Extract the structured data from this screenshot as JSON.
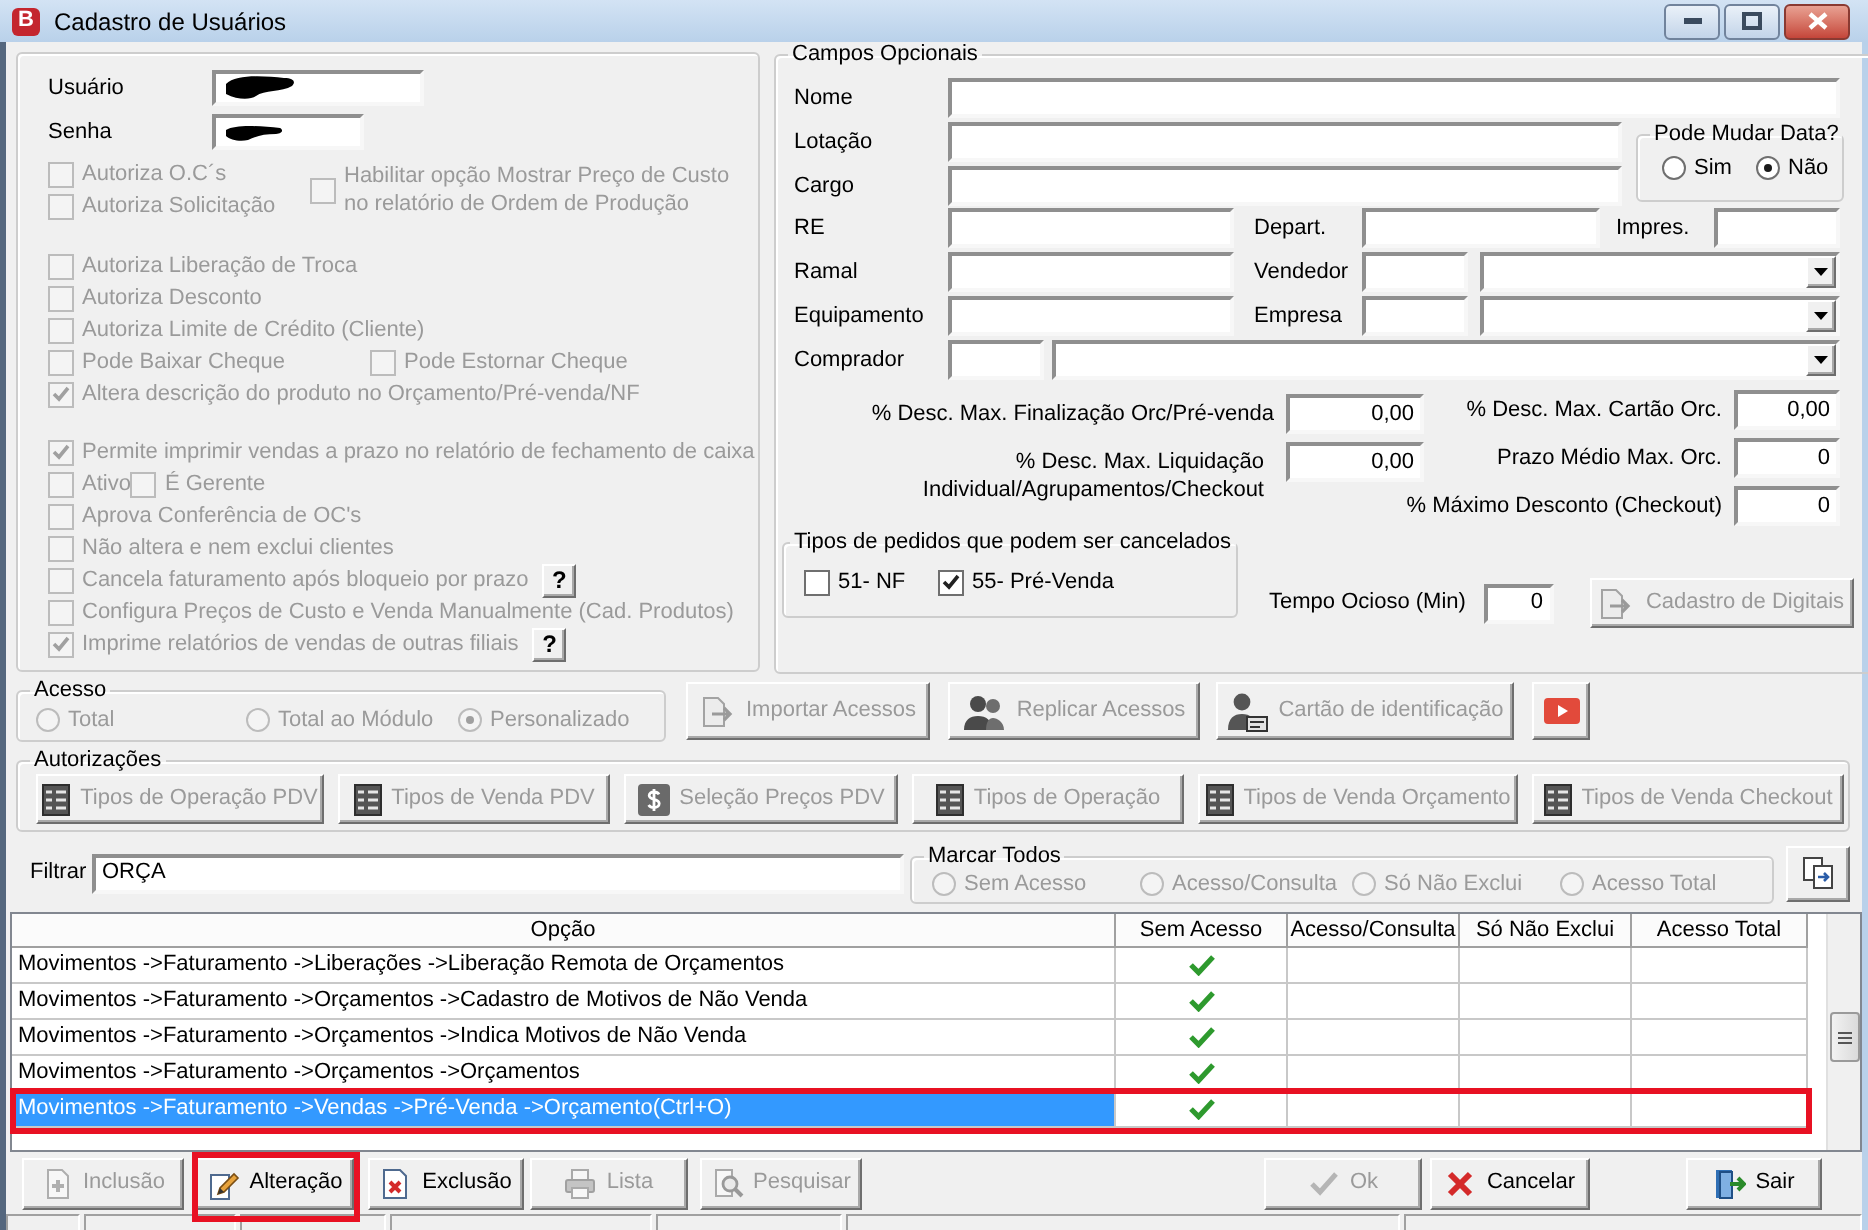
{
  "window": {
    "icon_letter": "B",
    "title": "Cadastro de Usuários"
  },
  "login": [
    {
      "label": "Usuário",
      "redacted": true
    },
    {
      "label": "Senha",
      "redacted": true
    }
  ],
  "permissions": {
    "disabled": true,
    "blocks": [
      {
        "kind": "with_side",
        "rows": [
          {
            "kind": "single",
            "items": [
              {
                "label": "Autoriza O.C´s",
                "checked": false
              }
            ]
          },
          {
            "kind": "single",
            "items": [
              {
                "label": "Autoriza Solicitação",
                "checked": false
              }
            ]
          }
        ],
        "side": {
          "lines": [
            "Habilitar opção Mostrar Preço de Custo",
            "no relatório de Ordem de Produção"
          ],
          "checked": false
        }
      },
      {
        "kind": "rows",
        "rows": [
          {
            "kind": "single",
            "items": [
              {
                "label": "Autoriza Liberação de Troca",
                "checked": false
              }
            ]
          },
          {
            "kind": "single",
            "items": [
              {
                "label": "Autoriza Desconto",
                "checked": false
              }
            ]
          },
          {
            "kind": "single",
            "items": [
              {
                "label": "Autoriza Limite de Crédito (Cliente)",
                "checked": false
              }
            ]
          },
          {
            "kind": "pair",
            "items": [
              {
                "label": "Pode Baixar Cheque",
                "checked": false
              },
              {
                "label": "Pode Estornar Cheque",
                "checked": false
              }
            ]
          },
          {
            "kind": "single",
            "items": [
              {
                "label": "Altera descrição do produto no Orçamento/Pré-venda/NF",
                "checked": true
              }
            ]
          }
        ]
      },
      {
        "kind": "rows",
        "rows": [
          {
            "kind": "single",
            "items": [
              {
                "label": "Permite imprimir vendas a prazo no relatório de fechamento de caixa",
                "checked": true
              }
            ]
          },
          {
            "kind": "inline",
            "items": [
              {
                "label": "Ativo",
                "checked": false
              },
              {
                "label": "É Gerente",
                "checked": false
              }
            ]
          },
          {
            "kind": "single",
            "items": [
              {
                "label": "Aprova Conferência de OC's",
                "checked": false
              }
            ]
          },
          {
            "kind": "single",
            "items": [
              {
                "label": "Não altera e nem exclui clientes",
                "checked": false
              }
            ]
          },
          {
            "kind": "single",
            "items": [
              {
                "label": "Cancela faturamento após bloqueio por prazo",
                "checked": false
              }
            ],
            "help": "?"
          },
          {
            "kind": "single",
            "items": [
              {
                "label": "Configura Preços de Custo e Venda Manualmente (Cad. Produtos)",
                "checked": false
              }
            ]
          },
          {
            "kind": "single",
            "items": [
              {
                "label": "Imprime relatórios de vendas de outras filiais",
                "checked": true
              }
            ],
            "help": "?"
          }
        ]
      }
    ]
  },
  "optional_fields": {
    "title": "Campos Opcionais",
    "nome": {
      "label": "Nome"
    },
    "lotacao": {
      "label": "Lotação"
    },
    "cargo": {
      "label": "Cargo"
    },
    "pode_mudar_data": {
      "title": "Pode Mudar Data?",
      "options": [
        {
          "label": "Sim",
          "selected": false
        },
        {
          "label": "Não",
          "selected": true
        }
      ]
    },
    "re": {
      "label": "RE"
    },
    "depart": {
      "label": "Depart."
    },
    "impres": {
      "label": "Impres."
    },
    "ramal": {
      "label": "Ramal"
    },
    "vendedor": {
      "label": "Vendedor"
    },
    "equipamento": {
      "label": "Equipamento"
    },
    "empresa": {
      "label": "Empresa"
    },
    "comprador": {
      "label": "Comprador"
    },
    "limits_left": [
      {
        "lines": [
          "% Desc. Max. Finalização Orc/Pré-venda"
        ],
        "value": "0,00"
      },
      {
        "lines": [
          "% Desc. Max. Liquidação",
          "Individual/Agrupamentos/Checkout"
        ],
        "value": "0,00"
      }
    ],
    "limits_right": [
      {
        "label": "% Desc. Max. Cartão Orc.",
        "value": "0,00"
      },
      {
        "label": "Prazo Médio Max. Orc.",
        "value": "0"
      },
      {
        "label": "% Máximo Desconto (Checkout)",
        "value": "0"
      }
    ],
    "cancel_types": {
      "title": "Tipos de pedidos que podem ser cancelados",
      "options": [
        {
          "label": "51- NF",
          "checked": false
        },
        {
          "label": "55- Pré-Venda",
          "checked": true
        }
      ]
    },
    "idle_time": {
      "label": "Tempo Ocioso (Min)",
      "value": "0"
    },
    "fingerprint_button": {
      "label": "Cadastro de Digitais",
      "disabled": true
    }
  },
  "access": {
    "title": "Acesso",
    "disabled": true,
    "options": [
      {
        "label": "Total",
        "selected": false
      },
      {
        "label": "Total ao Módulo",
        "selected": false
      },
      {
        "label": "Personalizado",
        "selected": true
      }
    ]
  },
  "access_buttons": [
    {
      "kind": "import",
      "label": "Importar Acessos",
      "disabled": true
    },
    {
      "kind": "replicate",
      "label": "Replicar Acessos",
      "disabled": true
    },
    {
      "kind": "id_card",
      "label": "Cartão de identificação",
      "disabled": true
    },
    {
      "kind": "video"
    }
  ],
  "authorizations": {
    "title": "Autorizações",
    "buttons": [
      {
        "kind": "list",
        "label": "Tipos de Operação PDV",
        "disabled": true
      },
      {
        "kind": "list",
        "label": "Tipos de Venda PDV",
        "disabled": true
      },
      {
        "kind": "price",
        "label": "Seleção Preços PDV",
        "disabled": true
      },
      {
        "kind": "list",
        "label": "Tipos de Operação",
        "disabled": true
      },
      {
        "kind": "list",
        "label": "Tipos de Venda Orçamento",
        "disabled": true
      },
      {
        "kind": "list",
        "label": "Tipos de Venda Checkout",
        "disabled": true
      }
    ]
  },
  "filter": {
    "label": "Filtrar",
    "value": "ORÇA"
  },
  "mark_all": {
    "title": "Marcar Todos",
    "disabled": true,
    "options": [
      {
        "label": "Sem Acesso",
        "selected": false
      },
      {
        "label": "Acesso/Consulta",
        "selected": false
      },
      {
        "label": "Só Não Exclui",
        "selected": false
      },
      {
        "label": "Acesso Total",
        "selected": false
      }
    ]
  },
  "table": {
    "columns": [
      "Opção",
      "Sem Acesso",
      "Acesso/Consulta",
      "Só Não Exclui",
      "Acesso Total"
    ],
    "rows": [
      {
        "option": "Movimentos ->Faturamento ->Liberações ->Liberação Remota de Orçamentos",
        "checks": [
          true,
          false,
          false,
          false
        ],
        "selected": false,
        "highlighted": false
      },
      {
        "option": "Movimentos ->Faturamento ->Orçamentos ->Cadastro de Motivos de Não Venda",
        "checks": [
          true,
          false,
          false,
          false
        ],
        "selected": false,
        "highlighted": false
      },
      {
        "option": "Movimentos ->Faturamento ->Orçamentos ->Indica Motivos de Não Venda",
        "checks": [
          true,
          false,
          false,
          false
        ],
        "selected": false,
        "highlighted": false
      },
      {
        "option": "Movimentos ->Faturamento ->Orçamentos ->Orçamentos",
        "checks": [
          true,
          false,
          false,
          false
        ],
        "selected": false,
        "highlighted": false
      },
      {
        "option": "Movimentos ->Faturamento ->Vendas ->Pré-Venda ->Orçamento(Ctrl+O)",
        "checks": [
          true,
          false,
          false,
          false
        ],
        "selected": true,
        "highlighted": true
      }
    ]
  },
  "toolbar": {
    "record_buttons": [
      {
        "kind": "insert",
        "label": "Inclusão",
        "disabled": true,
        "highlighted": false
      },
      {
        "kind": "edit",
        "label": "Alteração",
        "disabled": false,
        "highlighted": true
      },
      {
        "kind": "delete",
        "label": "Exclusão",
        "disabled": false,
        "highlighted": false
      },
      {
        "kind": "print",
        "label": "Lista",
        "disabled": true,
        "highlighted": false
      },
      {
        "kind": "search",
        "label": "Pesquisar",
        "disabled": true,
        "highlighted": false
      }
    ],
    "dialog_buttons": [
      {
        "kind": "ok",
        "label": "Ok",
        "disabled": true
      },
      {
        "kind": "cancel",
        "label": "Cancelar",
        "disabled": false
      },
      {
        "kind": "exit",
        "label": "Sair",
        "disabled": false
      }
    ]
  }
}
